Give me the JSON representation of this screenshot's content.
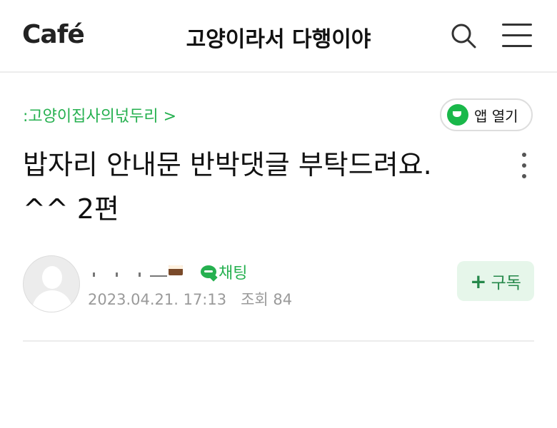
{
  "header": {
    "logo_text": "Café",
    "title": "고양이라서 다행이야",
    "icons": [
      "search-icon",
      "hamburger-menu-icon"
    ]
  },
  "post": {
    "board_name": ":고양이집사의넋두리 >",
    "open_app_label": "앱 열기",
    "title_line1": "밥자리 안내문 반박댓글 부탁드려요.",
    "title_line2": "^^ 2편",
    "author": {
      "chat_label": "채팅",
      "date": "2023.04.21. 17:13",
      "views_label": "조회 84"
    },
    "subscribe_label": "구독",
    "subscribe_plus": "+"
  },
  "colors": {
    "accent_green": "#25b04f",
    "subscribe_bg": "#e6f6ea",
    "meta_gray": "#9a9a9a"
  }
}
